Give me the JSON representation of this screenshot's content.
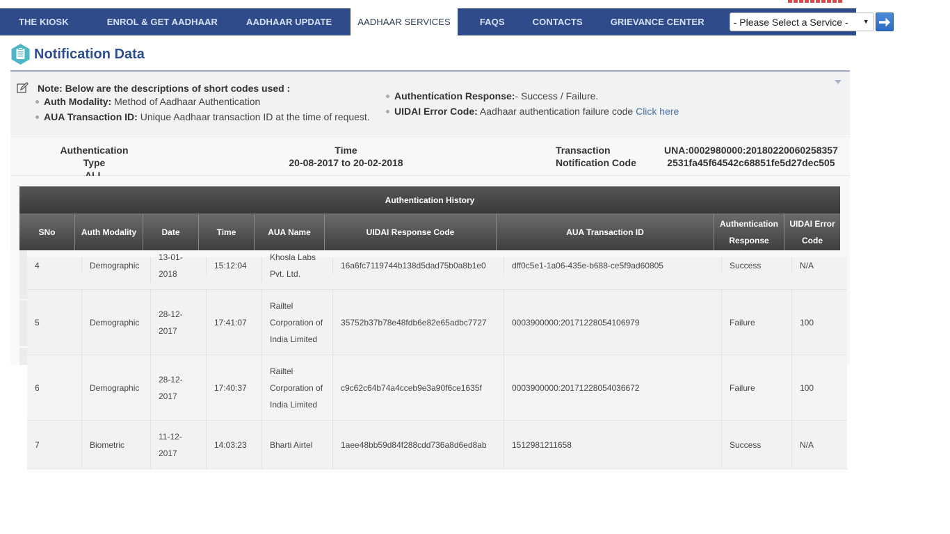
{
  "nav": {
    "items": [
      {
        "label": "THE KIOSK",
        "active": false
      },
      {
        "label": "ENROL & GET AADHAAR",
        "active": false
      },
      {
        "label": "AADHAAR UPDATE",
        "active": false
      },
      {
        "label": "AADHAAR SERVICES",
        "active": true
      },
      {
        "label": "FAQS",
        "active": false
      },
      {
        "label": "CONTACTS",
        "active": false
      },
      {
        "label": "GRIEVANCE CENTER",
        "active": false
      }
    ],
    "service_select": {
      "selected": "- Please Select a Service -"
    },
    "go_button_icon": "arrow-right-icon",
    "bar_color": "#2f4b8a"
  },
  "page": {
    "title": "Notification Data",
    "title_icon": "clipboard-icon",
    "title_color": "#2e4f8b"
  },
  "note": {
    "icon": "edit-icon",
    "heading": "Note: Below are the descriptions of short codes used :",
    "left_items": [
      {
        "term": "Auth Modality:",
        "desc": " Method of Aadhaar Authentication"
      },
      {
        "term": "AUA Transaction ID:",
        "desc": " Unique Aadhaar transaction ID at the time of request."
      }
    ],
    "right_items": [
      {
        "term": "Authentication Response:",
        "desc": "- Success / Failure."
      },
      {
        "term": "UIDAI Error Code:",
        "desc": " Aadhaar authentication failure code ",
        "link": "Click here"
      }
    ]
  },
  "info": {
    "auth_type_label": "Authentication Type",
    "auth_type_value": "ALL",
    "time_label": "Time",
    "time_value": "20-08-2017 to 20-02-2018",
    "txn_label_1": "Transaction",
    "txn_label_2": "Notification Code",
    "txn_value_1": "UNA:0002980000:20180220060258357",
    "txn_value_2": "2531fa45f64542c68851fe5d27dec505"
  },
  "table": {
    "title": "Authentication History",
    "columns": [
      "SNo",
      "Auth Modality",
      "Date",
      "Time",
      "AUA Name",
      "UIDAI Response Code",
      "AUA Transaction ID",
      "Authentication Response",
      "UIDAI Error Code"
    ],
    "column_lines": {
      "auth_response": [
        "Authentication",
        "Response"
      ],
      "error_code": [
        "UIDAI Error",
        "Code"
      ]
    },
    "rows": [
      {
        "sno": "4",
        "modality": "Demographic",
        "date_lines": [
          "13-01-",
          "2018"
        ],
        "time": "15:12:04",
        "aua_lines": [
          "Khosla Labs",
          "Pvt. Ltd."
        ],
        "response_code": "16a6fc7119744b138d5dad75b0a8b1e0",
        "txn_id": "dff0c5e1-1a06-435e-b688-ce5f9ad60805",
        "auth_response": "Success",
        "error_code": "N/A"
      },
      {
        "sno": "5",
        "modality": "Demographic",
        "date_lines": [
          "28-12-",
          "2017"
        ],
        "time": "17:41:07",
        "aua_lines": [
          "Railtel",
          "Corporation of",
          "India Limited"
        ],
        "response_code": "35752b37b78e48fdb6e82e65adbc7727",
        "txn_id": "0003900000:20171228054106979",
        "auth_response": "Failure",
        "error_code": "100"
      },
      {
        "sno": "6",
        "modality": "Demographic",
        "date_lines": [
          "28-12-",
          "2017"
        ],
        "time": "17:40:37",
        "aua_lines": [
          "Railtel",
          "Corporation of",
          "India Limited"
        ],
        "response_code": "c9c62c64b74a4cceb9e3a90f6ce1635f",
        "txn_id": "0003900000:20171228054036672",
        "auth_response": "Failure",
        "error_code": "100"
      },
      {
        "sno": "7",
        "modality": "Biometric",
        "date_lines": [
          "11-12-",
          "2017"
        ],
        "time": "14:03:23",
        "aua_lines": [
          "Bharti Airtel"
        ],
        "response_code": "1aee48bb59d84f288cdd736a8d6ed8ab",
        "txn_id": "1512981211658",
        "auth_response": "Success",
        "error_code": "N/A"
      }
    ]
  }
}
